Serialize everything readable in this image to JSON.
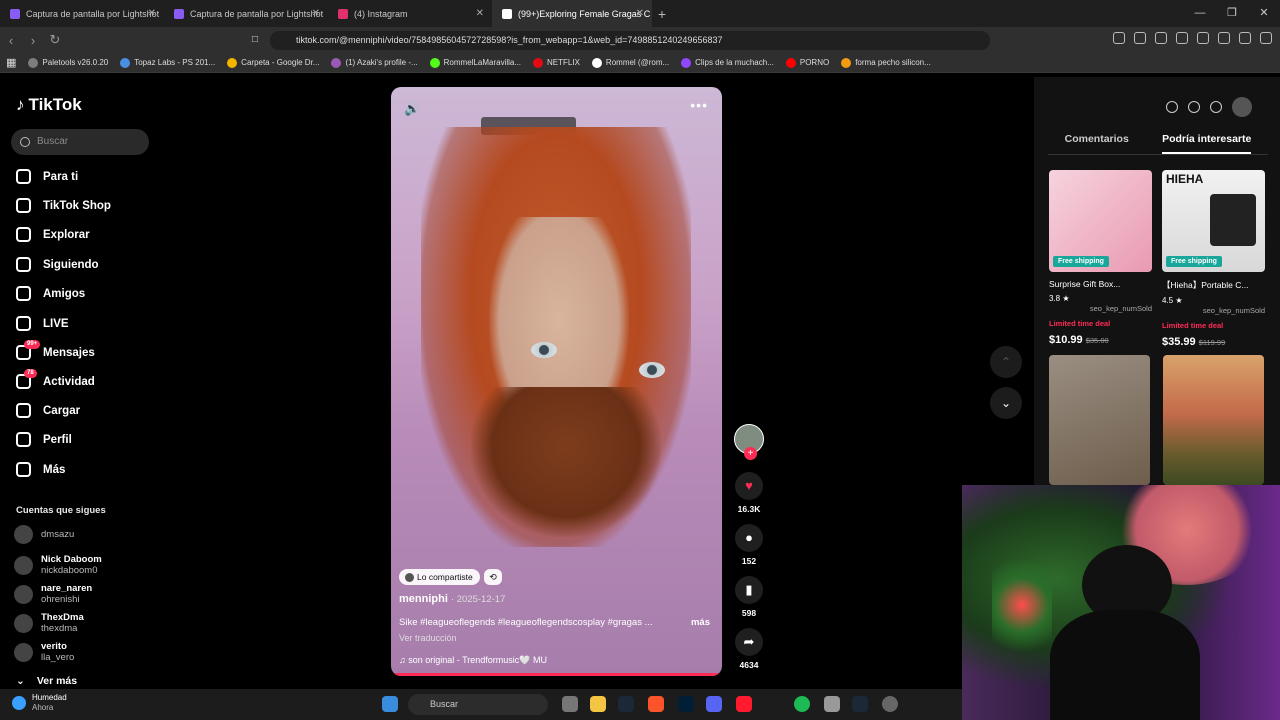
{
  "browser": {
    "tabs": [
      {
        "title": "Captura de pantalla por Lightshot",
        "fav_color": "#8a5cf6"
      },
      {
        "title": "Captura de pantalla por Lightshot",
        "fav_color": "#8a5cf6"
      },
      {
        "title": "(4) Instagram",
        "fav_color": "#e1306c"
      },
      {
        "title": "(99+)Exploring Female Gragas C",
        "fav_color": "#ffffff"
      }
    ],
    "new_tab": "+",
    "url": "tiktok.com/@menniphi/video/7584985604572728598?is_from_webapp=1&web_id=7498851240249656837",
    "bookmarks": [
      {
        "label": "Paletools v26.0.20",
        "color": "#7d7d7d"
      },
      {
        "label": "Topaz Labs - PS 201...",
        "color": "#4a90e2"
      },
      {
        "label": "Carpeta - Google Dr...",
        "color": "#f4b400"
      },
      {
        "label": "(1) Azaki's profile -...",
        "color": "#9b59b6"
      },
      {
        "label": "RommelLaMaravilla...",
        "color": "#53fc18"
      },
      {
        "label": "NETFLIX",
        "color": "#e50914"
      },
      {
        "label": "Rommel (@rom...",
        "color": "#ffffff"
      },
      {
        "label": "Clips de la muchach...",
        "color": "#9146ff"
      },
      {
        "label": "PORNO",
        "color": "#ff0000"
      },
      {
        "label": "forma pecho silicon...",
        "color": "#f39c12"
      }
    ]
  },
  "sidebar": {
    "logo": "TikTok",
    "search_placeholder": "Buscar",
    "nav": [
      {
        "label": "Para ti",
        "icon": "home-icon"
      },
      {
        "label": "TikTok Shop",
        "icon": "shop-icon"
      },
      {
        "label": "Explorar",
        "icon": "compass-icon"
      },
      {
        "label": "Siguiendo",
        "icon": "following-icon"
      },
      {
        "label": "Amigos",
        "icon": "friends-icon"
      },
      {
        "label": "LIVE",
        "icon": "live-icon"
      },
      {
        "label": "Mensajes",
        "icon": "messages-icon",
        "badge": "99+"
      },
      {
        "label": "Actividad",
        "icon": "activity-icon",
        "badge": "78"
      },
      {
        "label": "Cargar",
        "icon": "upload-icon"
      },
      {
        "label": "Perfil",
        "icon": "profile-icon"
      },
      {
        "label": "Más",
        "icon": "more-icon"
      }
    ],
    "following_title": "Cuentas que sigues",
    "following": [
      {
        "name": "",
        "handle": "dmsazu"
      },
      {
        "name": "Nick Daboom",
        "handle": "nickdaboom0"
      },
      {
        "name": "nare_naren",
        "handle": "ohrenishi"
      },
      {
        "name": "ThexDma",
        "handle": "thexdma"
      },
      {
        "name": "verito",
        "handle": "lla_vero"
      }
    ],
    "see_more": "Ver más"
  },
  "video": {
    "shared_label": "Lo compartiste",
    "author": "menniphi",
    "date": "· 2025-12-17",
    "description": "Sike #leagueoflegends #leagueoflegendscosplay #gragas ...",
    "more": "más",
    "translate": "Ver traducción",
    "sound": "son original - Trendformusic🤍 MU",
    "likes": "16.3K",
    "comments": "152",
    "saves": "598",
    "shares": "4634"
  },
  "right_panel": {
    "tabs": [
      "Comentarios",
      "Podría interesarte"
    ],
    "products": [
      {
        "name": "Surprise Gift Box...",
        "rating": "3.8 ★",
        "sold": "seo_kep_numSold",
        "deal": "Limited time deal",
        "price": "$10.99",
        "old_price": "$35.00",
        "shipping": "Free shipping",
        "bg": "#f3c6d3"
      },
      {
        "name": "【Hieha】Portable C...",
        "rating": "4.5 ★",
        "sold": "seo_kep_numSold",
        "deal": "Limited time deal",
        "price": "$35.99",
        "old_price": "$119.99",
        "shipping": "Free shipping",
        "bg": "#e9e9e9"
      }
    ],
    "product_brand": "HIEHA"
  },
  "taskbar": {
    "weather_title": "Humedad",
    "weather_sub": "Ahora",
    "search": "Buscar"
  }
}
